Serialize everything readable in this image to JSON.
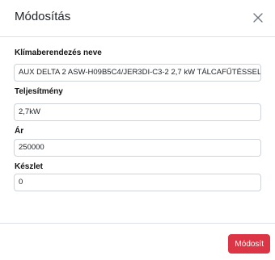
{
  "modal": {
    "title": "Módosítás",
    "close_icon": "close-icon"
  },
  "form": {
    "fields": [
      {
        "label": "Klímaberendezés neve",
        "value": "AUX DELTA 2 ASW-H09B5C4/JER3DI-C3-2 2,7 kW TÁLCAFŰTÉSSEL"
      },
      {
        "label": "Teljesítmény",
        "value": "2,7kW"
      },
      {
        "label": "Ár",
        "value": "250000"
      },
      {
        "label": "Készlet",
        "value": "0"
      }
    ]
  },
  "footer": {
    "submit_label": "Módosít"
  },
  "colors": {
    "submit_button": "#dc3545",
    "border": "#dee2e6",
    "input_border": "#ced4da"
  }
}
